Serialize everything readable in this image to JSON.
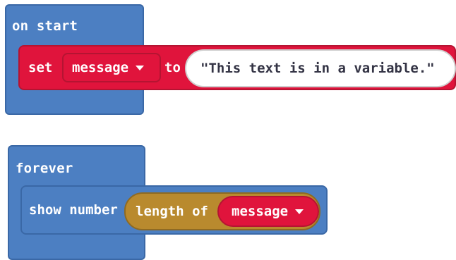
{
  "on_start": {
    "label": "on start",
    "set_block": {
      "keyword_set": "set",
      "variable": "message",
      "keyword_to": "to",
      "value": "\"This text is in a variable.\""
    }
  },
  "forever": {
    "label": "forever",
    "show_number": {
      "label": "show number",
      "length_of": {
        "label": "length of",
        "variable": "message"
      }
    }
  },
  "colors": {
    "event_blue": "#4C7FC2",
    "variable_red": "#E0143C",
    "text_gold": "#B98A2E"
  }
}
